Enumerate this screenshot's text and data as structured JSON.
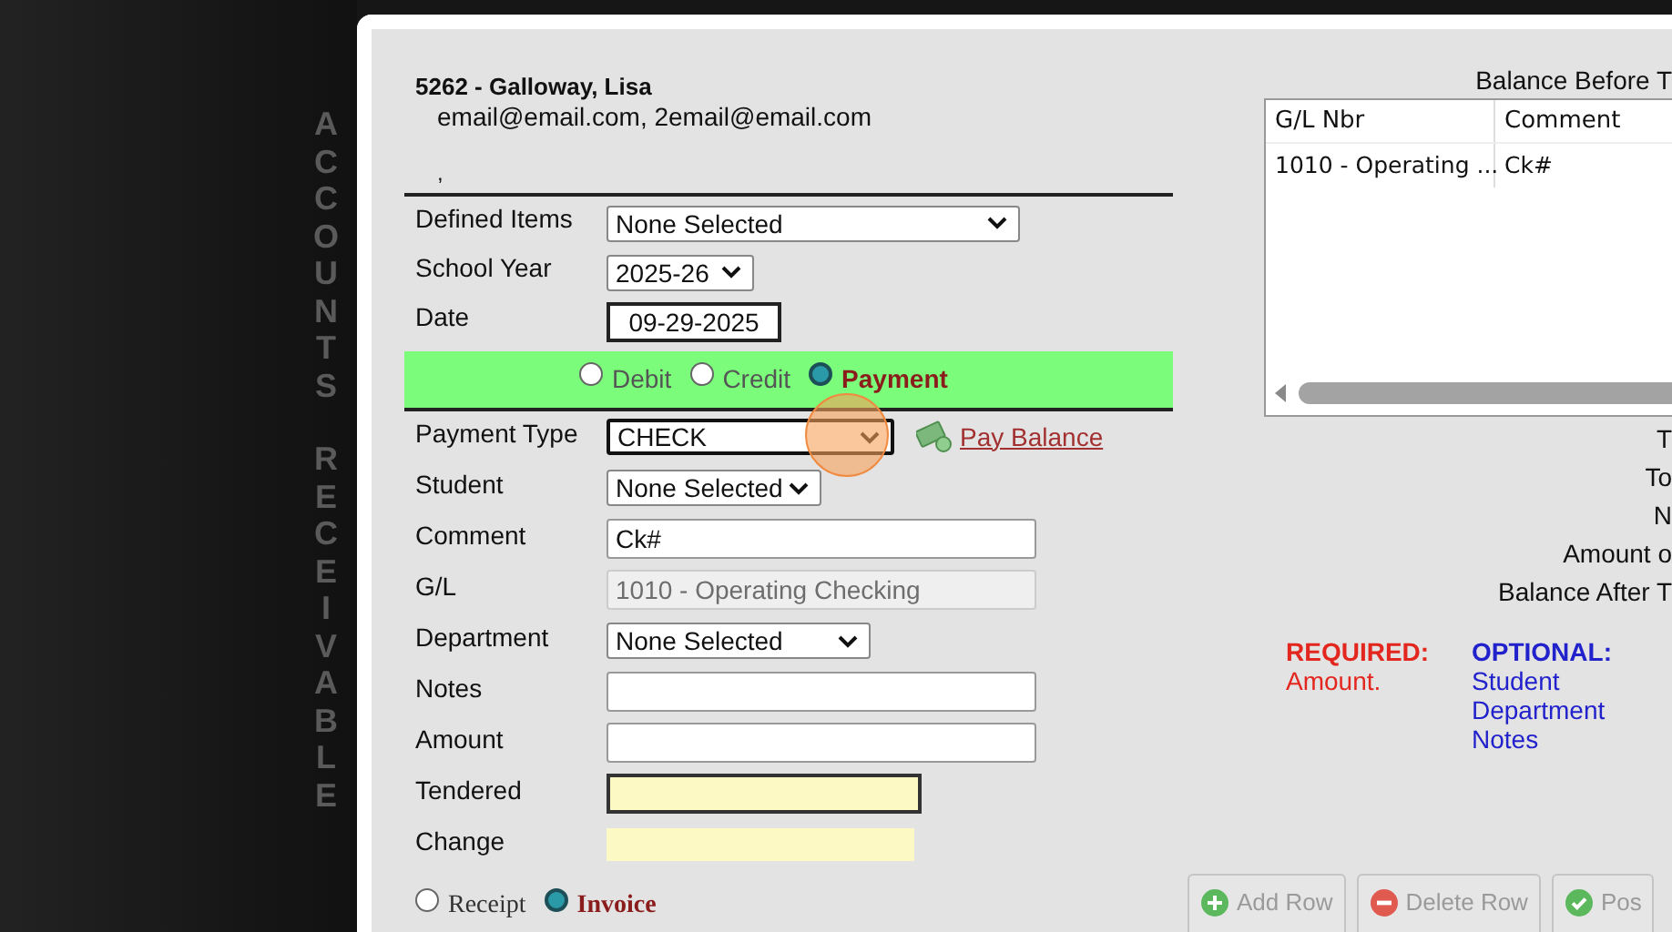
{
  "sidebar_words": [
    "ACCOUNTS",
    "RECEIVABLE"
  ],
  "customer": {
    "name": "5262 - Galloway, Lisa",
    "emails": "email@email.com, 2email@email.com",
    "address": ","
  },
  "header_fields": [
    {
      "label": "Defined Items",
      "kind": "select",
      "value": "None Selected"
    },
    {
      "label": "School Year",
      "kind": "select",
      "value": "2025-26"
    },
    {
      "label": "Date",
      "kind": "date",
      "value": "09-29-2025"
    }
  ],
  "entry_type": [
    {
      "label": "Debit",
      "selected": false
    },
    {
      "label": "Credit",
      "selected": false
    },
    {
      "label": "Payment",
      "selected": true
    }
  ],
  "fields": [
    {
      "label": "Payment Type",
      "kind": "select",
      "value": "CHECK",
      "focused": true,
      "link": "Pay Balance"
    },
    {
      "label": "Student",
      "kind": "select",
      "value": "None Selected"
    },
    {
      "label": "Comment",
      "kind": "text",
      "value": "Ck#"
    },
    {
      "label": "G/L",
      "kind": "readonly",
      "value": "1010 - Operating Checking"
    },
    {
      "label": "Department",
      "kind": "select",
      "value": "None Selected"
    },
    {
      "label": "Notes",
      "kind": "text"
    },
    {
      "label": "Amount",
      "kind": "text"
    },
    {
      "label": "Tendered",
      "kind": "highlight"
    },
    {
      "label": "Change",
      "kind": "display"
    }
  ],
  "document_type": [
    {
      "label": "Receipt",
      "selected": false
    },
    {
      "label": "Invoice",
      "selected": true
    }
  ],
  "balance_before_label": "Balance Before T",
  "table": {
    "columns": [
      "G/L Nbr",
      "Comment"
    ],
    "rows": [
      [
        "1010 - Operating ...",
        "Ck#"
      ]
    ]
  },
  "summary_labels": [
    "T",
    "To",
    "N",
    "Amount o",
    "Balance After T"
  ],
  "required": {
    "title": "REQUIRED:",
    "items": [
      "Amount."
    ]
  },
  "optional": {
    "title": "OPTIONAL:",
    "items": [
      "Student",
      "Department",
      "Notes"
    ]
  },
  "buttons": [
    {
      "label": "Add Row",
      "kind": "add"
    },
    {
      "label": "Delete Row",
      "kind": "delete"
    },
    {
      "label": "Pos",
      "kind": "post"
    }
  ]
}
